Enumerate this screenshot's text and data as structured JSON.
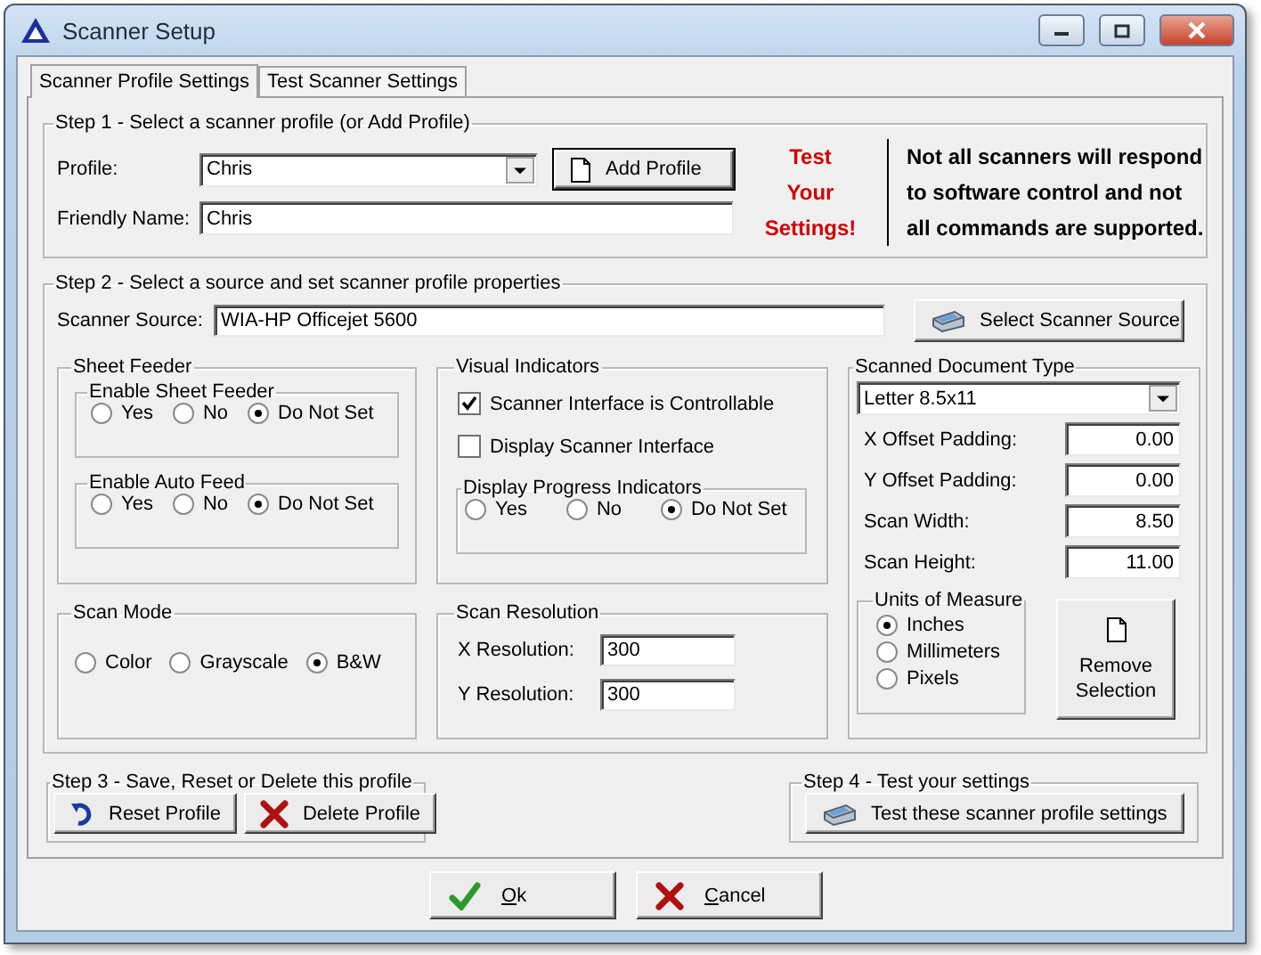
{
  "window": {
    "title": "Scanner Setup"
  },
  "tabs": [
    {
      "label": "Scanner Profile Settings",
      "selected": true
    },
    {
      "label": "Test Scanner Settings",
      "selected": false
    }
  ],
  "step1": {
    "title": "Step 1 - Select a scanner profile (or Add Profile)",
    "profile_label": "Profile:",
    "profile_value": "Chris",
    "friendly_name_label": "Friendly Name:",
    "friendly_name_value": "Chris",
    "add_button": "Add Profile",
    "warning_lines": [
      "Test",
      "Your",
      "Settings!"
    ],
    "note_lines": [
      "Not all scanners will respond",
      "to software control and not",
      "all commands are supported."
    ]
  },
  "step2": {
    "title": "Step 2 - Select a source and set scanner profile properties",
    "source_label": "Scanner Source:",
    "source_value": "WIA-HP Officejet 5600",
    "select_source_button": "Select Scanner Source",
    "sheet_feeder": {
      "title": "Sheet Feeder",
      "groups": [
        {
          "title": "Enable Sheet Feeder",
          "options": [
            {
              "label": "Yes",
              "selected": false
            },
            {
              "label": "No",
              "selected": false
            },
            {
              "label": "Do Not Set",
              "selected": true
            }
          ]
        },
        {
          "title": "Enable Auto Feed",
          "options": [
            {
              "label": "Yes",
              "selected": false
            },
            {
              "label": "No",
              "selected": false
            },
            {
              "label": "Do Not Set",
              "selected": true
            }
          ]
        }
      ]
    },
    "scan_mode": {
      "title": "Scan Mode",
      "options": [
        {
          "label": "Color",
          "selected": false
        },
        {
          "label": "Grayscale",
          "selected": false
        },
        {
          "label": "B&W",
          "selected": true
        }
      ]
    },
    "visual_indicators": {
      "title": "Visual Indicators",
      "checkboxes": [
        {
          "label": "Scanner Interface is Controllable",
          "checked": true
        },
        {
          "label": "Display Scanner Interface",
          "checked": false
        }
      ],
      "progress": {
        "title": "Display Progress Indicators",
        "options": [
          {
            "label": "Yes",
            "selected": false
          },
          {
            "label": "No",
            "selected": false
          },
          {
            "label": "Do Not Set",
            "selected": true
          }
        ]
      }
    },
    "scan_resolution": {
      "title": "Scan Resolution",
      "fields": [
        {
          "label": "X Resolution:",
          "value": "300"
        },
        {
          "label": "Y Resolution:",
          "value": "300"
        }
      ]
    },
    "document_type": {
      "title": "Scanned Document Type",
      "value": "Letter 8.5x11",
      "fields": [
        {
          "label": "X Offset Padding:",
          "value": "0.00"
        },
        {
          "label": "Y Offset Padding:",
          "value": "0.00"
        },
        {
          "label": "Scan Width:",
          "value": "8.50"
        },
        {
          "label": "Scan Height:",
          "value": "11.00"
        }
      ],
      "units": {
        "title": "Units of Measure",
        "options": [
          {
            "label": "Inches",
            "selected": true
          },
          {
            "label": "Millimeters",
            "selected": false
          },
          {
            "label": "Pixels",
            "selected": false
          }
        ]
      },
      "remove_button": [
        "Remove",
        "Selection"
      ]
    }
  },
  "step3": {
    "title": "Step 3 - Save, Reset or Delete this profile",
    "buttons": [
      {
        "label": "Reset Profile",
        "kind": "reset"
      },
      {
        "label": "Delete Profile",
        "kind": "delete"
      }
    ]
  },
  "step4": {
    "title": "Step 4 - Test your settings",
    "button": "Test these scanner profile settings"
  },
  "dialog_buttons": [
    {
      "label": "Ok",
      "kind": "ok"
    },
    {
      "label": "Cancel",
      "kind": "cancel"
    }
  ]
}
